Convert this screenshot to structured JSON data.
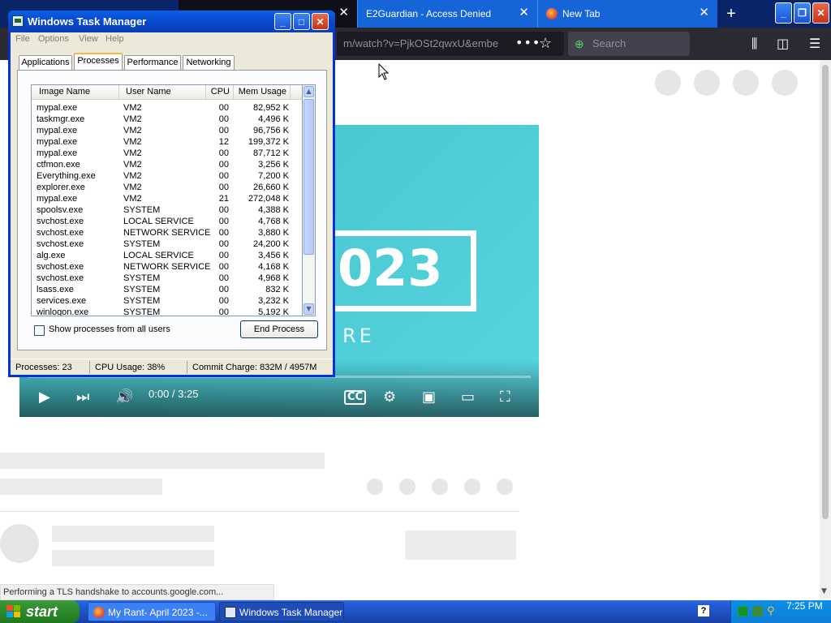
{
  "firefox": {
    "tabs": [
      {
        "label": "",
        "active": true
      },
      {
        "label": "E2Guardian - Access Denied"
      },
      {
        "label": "New Tab"
      }
    ],
    "url_text": "m/watch?v=PjkOSt2qwxU&embe",
    "search_placeholder": "Search",
    "status_text": "Performing a TLS handshake to accounts.google.com..."
  },
  "video": {
    "overlay_number": "023",
    "overlay_subtext": "RE",
    "time_text": "0:00 / 3:25",
    "progress_fraction": 0.0
  },
  "task_manager": {
    "title": "Windows Task Manager",
    "menu": [
      "File",
      "Options",
      "View",
      "Help"
    ],
    "tabs": [
      "Applications",
      "Processes",
      "Performance",
      "Networking"
    ],
    "active_tab": "Processes",
    "columns": [
      "Image Name",
      "User Name",
      "CPU",
      "Mem Usage"
    ],
    "processes": [
      [
        "mypal.exe",
        "VM2",
        "00",
        "82,952 K"
      ],
      [
        "taskmgr.exe",
        "VM2",
        "00",
        "4,496 K"
      ],
      [
        "mypal.exe",
        "VM2",
        "00",
        "96,756 K"
      ],
      [
        "mypal.exe",
        "VM2",
        "12",
        "199,372 K"
      ],
      [
        "mypal.exe",
        "VM2",
        "00",
        "87,712 K"
      ],
      [
        "ctfmon.exe",
        "VM2",
        "00",
        "3,256 K"
      ],
      [
        "Everything.exe",
        "VM2",
        "00",
        "7,200 K"
      ],
      [
        "explorer.exe",
        "VM2",
        "00",
        "26,660 K"
      ],
      [
        "mypal.exe",
        "VM2",
        "21",
        "272,048 K"
      ],
      [
        "spoolsv.exe",
        "SYSTEM",
        "00",
        "4,388 K"
      ],
      [
        "svchost.exe",
        "LOCAL SERVICE",
        "00",
        "4,768 K"
      ],
      [
        "svchost.exe",
        "NETWORK SERVICE",
        "00",
        "3,880 K"
      ],
      [
        "svchost.exe",
        "SYSTEM",
        "00",
        "24,200 K"
      ],
      [
        "alg.exe",
        "LOCAL SERVICE",
        "00",
        "3,456 K"
      ],
      [
        "svchost.exe",
        "NETWORK SERVICE",
        "00",
        "4,168 K"
      ],
      [
        "svchost.exe",
        "SYSTEM",
        "00",
        "4,968 K"
      ],
      [
        "lsass.exe",
        "SYSTEM",
        "00",
        "832 K"
      ],
      [
        "services.exe",
        "SYSTEM",
        "00",
        "3,232 K"
      ],
      [
        "winlogon.exe",
        "SYSTEM",
        "00",
        "5,192 K"
      ]
    ],
    "show_all_label": "Show processes from all users",
    "show_all_checked": false,
    "end_process_label": "End Process",
    "status": {
      "processes": "Processes: 23",
      "cpu": "CPU Usage: 38%",
      "commit": "Commit Charge: 832M / 4957M"
    }
  },
  "taskbar": {
    "start_label": "start",
    "buttons": [
      {
        "label": "My Rant- April 2023 -..."
      },
      {
        "label": "Windows Task Manager"
      }
    ],
    "clock": "7:25 PM"
  },
  "colors": {
    "xp_blue": "#245edb",
    "start_green": "#2e8b2e",
    "ff_tab_blue": "#1565d8",
    "video_teal": "#4ccbd3"
  }
}
